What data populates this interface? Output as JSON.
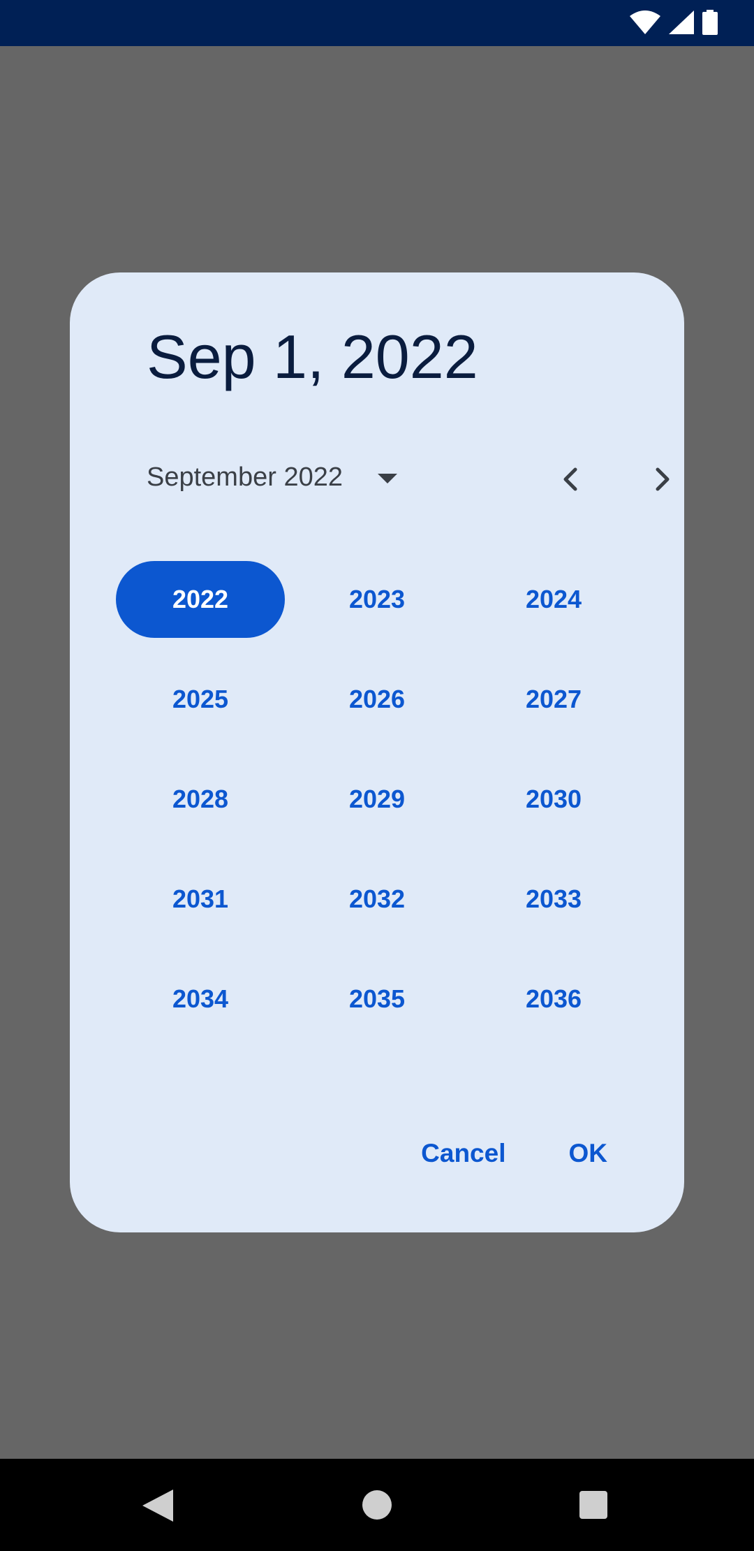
{
  "status_bar": {
    "icons": [
      "wifi-icon",
      "cell-signal-icon",
      "battery-icon"
    ]
  },
  "dialog": {
    "headline": "Sep 1, 2022",
    "month_selector": {
      "label": "September 2022",
      "dropdown_icon": "dropdown-arrow-icon",
      "prev_icon": "chevron-left-icon",
      "next_icon": "chevron-right-icon"
    },
    "years": [
      "2022",
      "2023",
      "2024",
      "2025",
      "2026",
      "2027",
      "2028",
      "2029",
      "2030",
      "2031",
      "2032",
      "2033",
      "2034",
      "2035",
      "2036"
    ],
    "selected_year": "2022",
    "actions": {
      "cancel_label": "Cancel",
      "ok_label": "OK"
    }
  },
  "nav_bar": {
    "icons": [
      "back-icon",
      "home-icon",
      "recents-icon"
    ]
  },
  "colors": {
    "status_bar": "#002055",
    "scrim": "#666666",
    "dialog_bg": "#e0eaf8",
    "accent": "#0c57d0",
    "headline": "#0a1c3e"
  }
}
